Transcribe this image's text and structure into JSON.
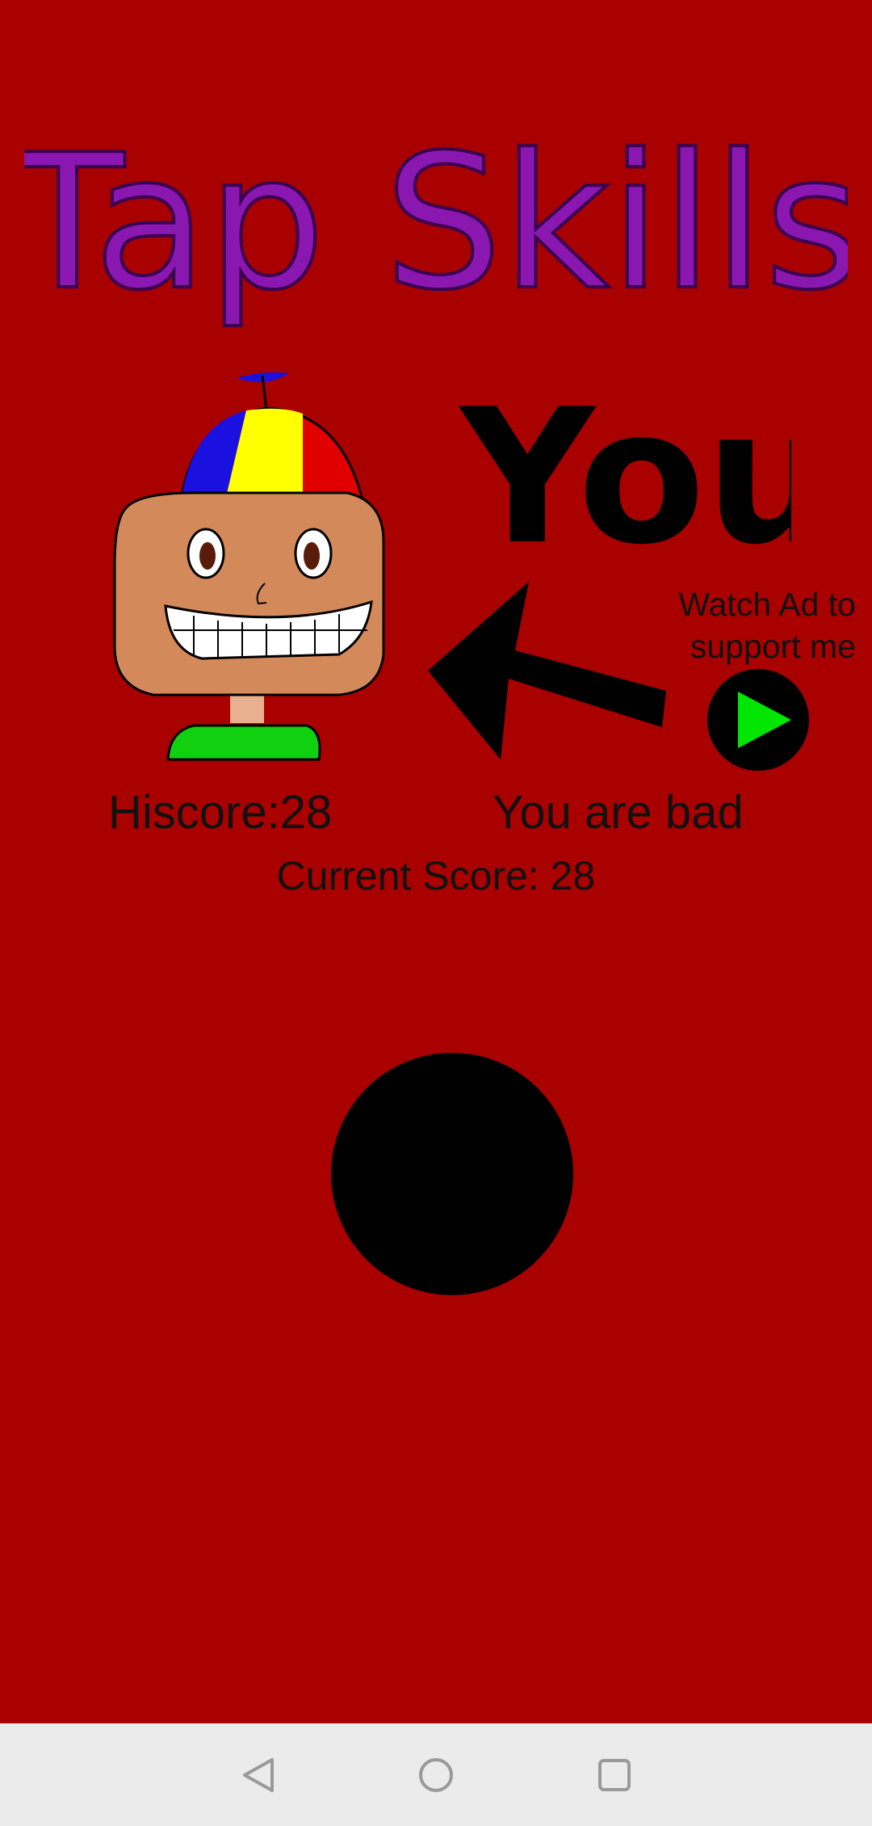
{
  "app": {
    "title": "Tap Skills",
    "you_label": "You"
  },
  "ad": {
    "label_line1": "Watch Ad to",
    "label_line2": "support me",
    "button_icon": "play-icon"
  },
  "scores": {
    "hiscore": "Hiscore:28",
    "taunt": "You are bad",
    "current": "Current Score: 28"
  },
  "colors": {
    "background": "#a90000",
    "title": "#8a17b0",
    "play_triangle": "#00e600",
    "nav_bar": "#ebebeb"
  },
  "nav": {
    "back_icon": "back-triangle-icon",
    "home_icon": "home-circle-icon",
    "recents_icon": "recents-square-icon"
  }
}
